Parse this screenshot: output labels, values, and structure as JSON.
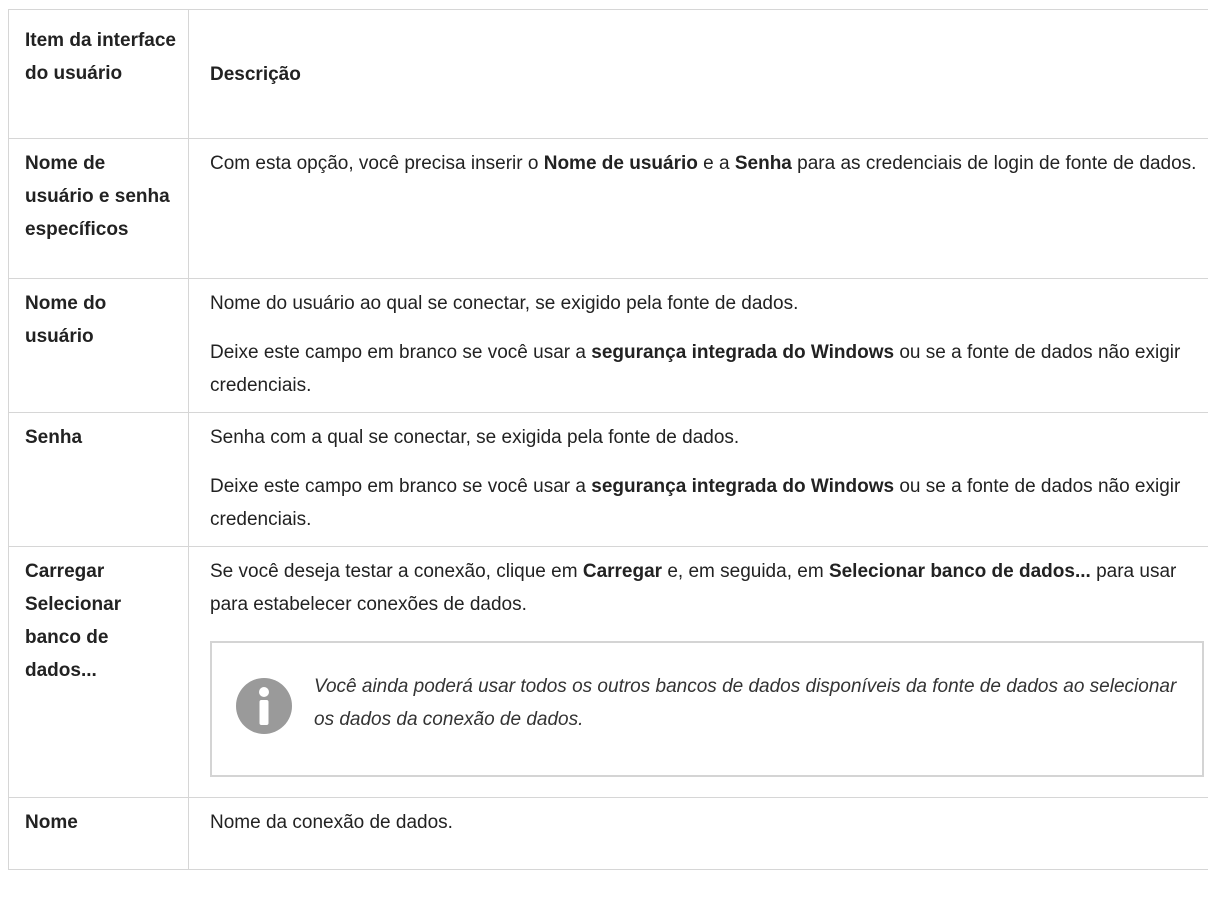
{
  "table": {
    "header": {
      "col1": "Item da interface do usuário",
      "col2": "Descrição"
    },
    "rows": [
      {
        "item": "Nome de usuário e senha específicos",
        "p1_a": "Com esta opção, você precisa inserir o ",
        "p1_b": "Nome de usuário",
        "p1_c": " e a ",
        "p1_d": "Senha",
        "p1_e": " para as credenciais de login de fonte de dados."
      },
      {
        "item": "Nome do usuário",
        "p1": "Nome do usuário ao qual se conectar, se exigido pela fonte de dados.",
        "p2_a": "Deixe este campo em branco se você usar a ",
        "p2_b": "segurança integrada do Windows",
        "p2_c": " ou se a fonte de dados não exigir credenciais."
      },
      {
        "item": "Senha",
        "p1": "Senha com a qual se conectar, se exigida pela fonte de dados.",
        "p2_a": "Deixe este campo em branco se você usar a ",
        "p2_b": "segurança integrada do Windows",
        "p2_c": " ou se a fonte de dados não exigir credenciais."
      },
      {
        "item": "Carregar Selecionar banco de dados...",
        "p1_a": "Se você deseja testar a conexão, clique em ",
        "p1_b": "Carregar",
        "p1_c": " e, em seguida, em ",
        "p1_d": "Selecionar banco de dados...",
        "p1_e": " para usar para estabelecer conexões de dados.",
        "note": {
          "icon": "info-icon",
          "text": "Você ainda poderá usar todos os outros bancos de dados disponíveis da fonte de dados ao selecionar os dados da conexão de dados."
        }
      },
      {
        "item": "Nome",
        "p1": "Nome da conexão de dados."
      }
    ]
  },
  "colors": {
    "text": "#222222",
    "border": "#d6d6d6",
    "note_border": "#d4d4d4",
    "icon": "#9a9a9a"
  }
}
